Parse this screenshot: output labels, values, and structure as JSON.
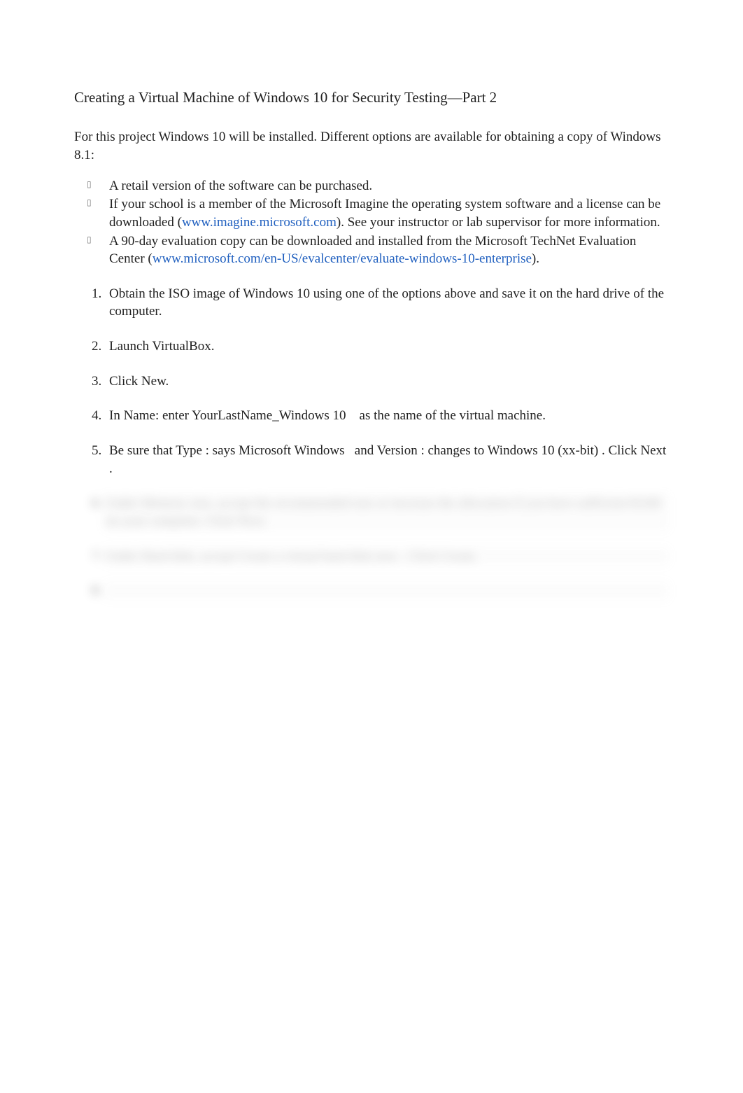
{
  "title": "Creating a Virtual Machine of Windows 10 for Security Testing—Part 2",
  "intro": "For this project Windows 10 will be installed. Different options are available for obtaining a copy of Windows 8.1:",
  "bullets": {
    "b1": "A retail version of the software can be purchased.",
    "b2a": "If your school is a member of the Microsoft Imagine the operating system software and a license can be downloaded (",
    "b2_link": "www.imagine.microsoft.com",
    "b2b": "). See your instructor or lab supervisor for more information.",
    "b3a": "A 90-day evaluation copy can be downloaded and installed from the Microsoft TechNet Evaluation Center (",
    "b3_link": "www.microsoft.com/en-US/evalcenter/evaluate-windows-10-enterprise",
    "b3b": ")."
  },
  "steps": {
    "s1": "Obtain the ISO image of Windows 10 using one of the options above and save it on the hard drive of the computer.",
    "s2": "Launch VirtualBox.",
    "s3": "Click New.",
    "s4a": "In ",
    "s4b": "Name",
    "s4c": ": enter ",
    "s4d": "YourLastName_Windows 10",
    "s4e": " as the name of the virtual machine.",
    "s5a": "Be sure that ",
    "s5b": "Type",
    "s5c": " : says ",
    "s5d": "Microsoft Windows",
    "s5e": " and ",
    "s5f": "Version",
    "s5g": " : changes to ",
    "s5h": "Windows 10 (xx-bit)",
    "s5i": " . Click ",
    "s5j": "Next",
    "s5k": " .",
    "s6": "Under Memory size, accept the recommended size or increase the allocation if you have sufficient RAM on your computer. Click Next.",
    "s7": "Under Hard disk, accept Create a virtual hard disk now . Click Create."
  }
}
